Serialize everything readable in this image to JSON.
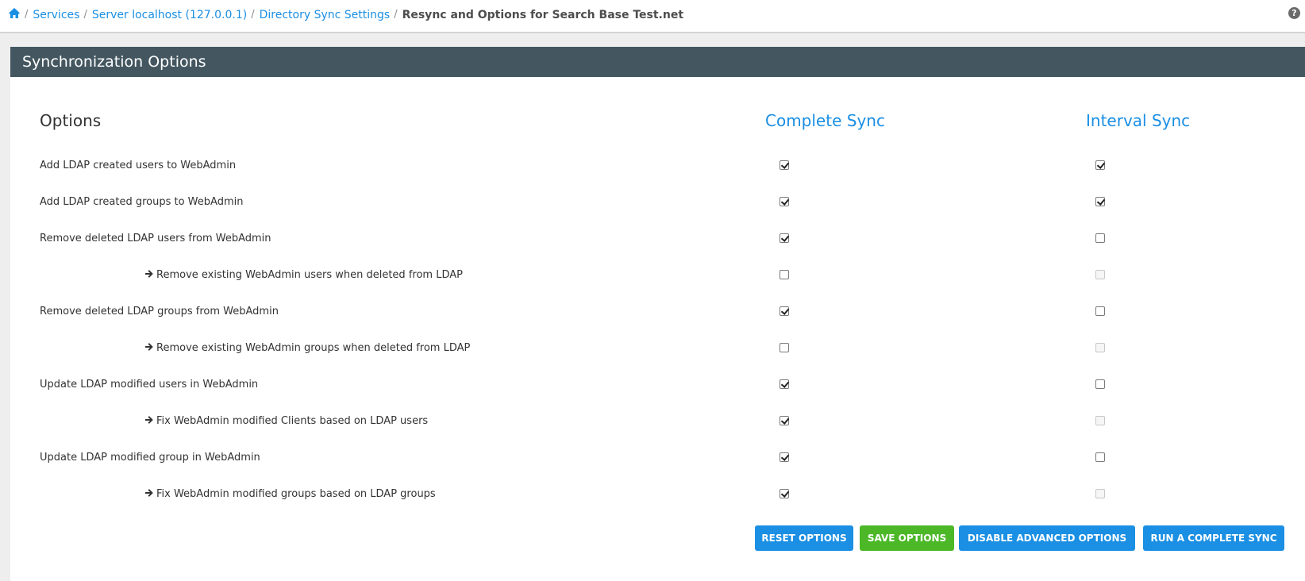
{
  "breadcrumb": {
    "home_icon": "home-icon",
    "items": [
      "Services",
      "Server localhost (127.0.0.1)",
      "Directory Sync Settings"
    ],
    "separator": "/",
    "current": "Resync and Options for Search Base Test.net"
  },
  "help_icon": "?",
  "panel": {
    "title": "Synchronization Options",
    "columns": {
      "options": "Options",
      "complete": "Complete Sync",
      "interval": "Interval Sync"
    },
    "rows": [
      {
        "label": "Add LDAP created users to WebAdmin",
        "indent": false,
        "complete": true,
        "interval": true,
        "interval_disabled": false
      },
      {
        "label": "Add LDAP created groups to WebAdmin",
        "indent": false,
        "complete": true,
        "interval": true,
        "interval_disabled": false
      },
      {
        "label": "Remove deleted LDAP users from WebAdmin",
        "indent": false,
        "complete": true,
        "interval": false,
        "interval_disabled": false
      },
      {
        "label": "Remove existing WebAdmin users when deleted from LDAP",
        "indent": true,
        "complete": false,
        "interval": false,
        "interval_disabled": true
      },
      {
        "label": "Remove deleted LDAP groups from WebAdmin",
        "indent": false,
        "complete": true,
        "interval": false,
        "interval_disabled": false
      },
      {
        "label": "Remove existing WebAdmin groups when deleted from LDAP",
        "indent": true,
        "complete": false,
        "interval": false,
        "interval_disabled": true
      },
      {
        "label": "Update LDAP modified users in WebAdmin",
        "indent": false,
        "complete": true,
        "interval": false,
        "interval_disabled": false
      },
      {
        "label": "Fix WebAdmin modified Clients based on LDAP users",
        "indent": true,
        "complete": true,
        "interval": false,
        "interval_disabled": true
      },
      {
        "label": "Update LDAP modified group in WebAdmin",
        "indent": false,
        "complete": true,
        "interval": false,
        "interval_disabled": false
      },
      {
        "label": "Fix WebAdmin modified groups based on LDAP groups",
        "indent": true,
        "complete": true,
        "interval": false,
        "interval_disabled": true
      }
    ]
  },
  "buttons": {
    "reset": "RESET OPTIONS",
    "save": "SAVE OPTIONS",
    "disable_advanced": "DISABLE ADVANCED OPTIONS",
    "run_complete": "RUN A COMPLETE SYNC"
  },
  "colors": {
    "accent": "#1a8fe3",
    "header": "#445761",
    "save": "#4cb828"
  }
}
